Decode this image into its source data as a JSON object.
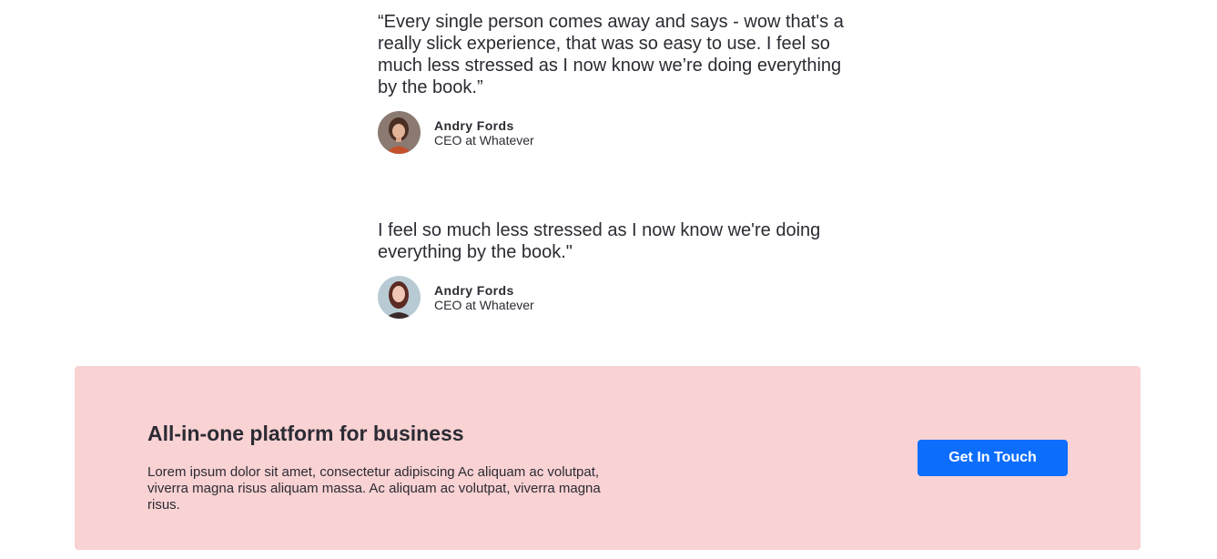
{
  "testimonials": [
    {
      "quote": "“Every single person comes away and says - wow that's a really slick experience, that was so easy to use. I feel so much less stressed as I now know we’re doing everything by the book.”",
      "author_name": "Andry Fords",
      "author_role": "CEO at Whatever"
    },
    {
      "quote": "I feel so much less stressed as I now know we're doing everything by the book.\"",
      "author_name": "Andry Fords",
      "author_role": "CEO at Whatever"
    }
  ],
  "cta": {
    "title": "All-in-one platform for business",
    "body": "Lorem ipsum dolor sit amet, consectetur adipiscing Ac aliquam ac volutpat, viverra magna risus aliquam massa. Ac aliquam ac volutpat, viverra magna risus.",
    "button_label": "Get In Touch"
  },
  "colors": {
    "cta_background": "#f9d2d4",
    "button": "#0d6efd",
    "text": "#2b2b33"
  }
}
